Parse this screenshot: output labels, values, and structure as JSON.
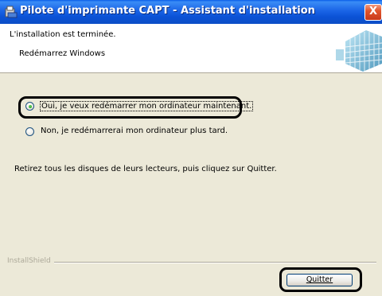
{
  "window": {
    "title": "Pilote d'imprimante CAPT - Assistant d'installation",
    "close_glyph": "X"
  },
  "header": {
    "title": "L'installation est terminée.",
    "subtitle": "Redémarrez Windows",
    "graphic": "computer-grid-graphic"
  },
  "options": [
    {
      "label": "Oui, je veux redémarrer mon ordinateur maintenant.",
      "selected": true
    },
    {
      "label": "Non, je redémarrerai mon ordinateur plus tard.",
      "selected": false
    }
  ],
  "instruction": "Retirez tous les disques de leurs lecteurs, puis cliquez sur Quitter.",
  "footer": {
    "brand": "InstallShield",
    "quit_label": "Quitter"
  },
  "colors": {
    "titlebar": "#0b52d6",
    "dialog_bg": "#ece9d8",
    "highlight": "#000000"
  }
}
